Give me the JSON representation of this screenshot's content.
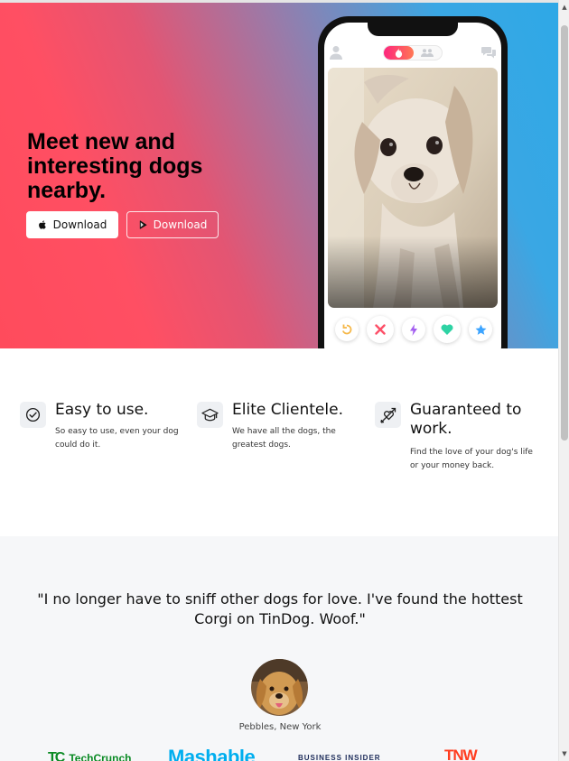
{
  "hero": {
    "title": "Meet new and interesting dogs nearby.",
    "download_apple_label": "Download",
    "download_play_label": "Download",
    "gradient_colors": [
      "#ff4b5c",
      "#9b7aa8",
      "#2ea8e6"
    ]
  },
  "phone": {
    "top_icons": [
      "profile-icon",
      "flame-icon",
      "people-icon",
      "chat-bubbles-icon"
    ],
    "actions": [
      {
        "name": "rewind",
        "icon": "rewind-icon",
        "color": "#f5b748"
      },
      {
        "name": "nope",
        "icon": "close-x-icon",
        "color": "#fd5068"
      },
      {
        "name": "boost",
        "icon": "lightning-icon",
        "color": "#a35ef0"
      },
      {
        "name": "like",
        "icon": "heart-icon",
        "color": "#2ed3a4"
      },
      {
        "name": "super-like",
        "icon": "star-icon",
        "color": "#3ca4ff"
      }
    ]
  },
  "features": [
    {
      "icon": "check-circle-icon",
      "title": "Easy to use.",
      "text": "So easy to use, even your dog could do it."
    },
    {
      "icon": "graduation-cap-icon",
      "title": "Elite Clientele.",
      "text": "We have all the dogs, the greatest dogs."
    },
    {
      "icon": "heart-arrow-icon",
      "title": "Guaranteed to work.",
      "text": "Find the love of your dog's life or your money back."
    }
  ],
  "testimonial": {
    "quote": "\"I no longer have to sniff other dogs for love. I've found the hottest Corgi on TinDog. Woof.\"",
    "author": "Pebbles, New York"
  },
  "press": {
    "techcrunch_mark": "TC",
    "techcrunch": "TechCrunch",
    "mashable": "Mashable",
    "business_insider": "BUSINESS INSIDER",
    "tnw": "TNW"
  }
}
